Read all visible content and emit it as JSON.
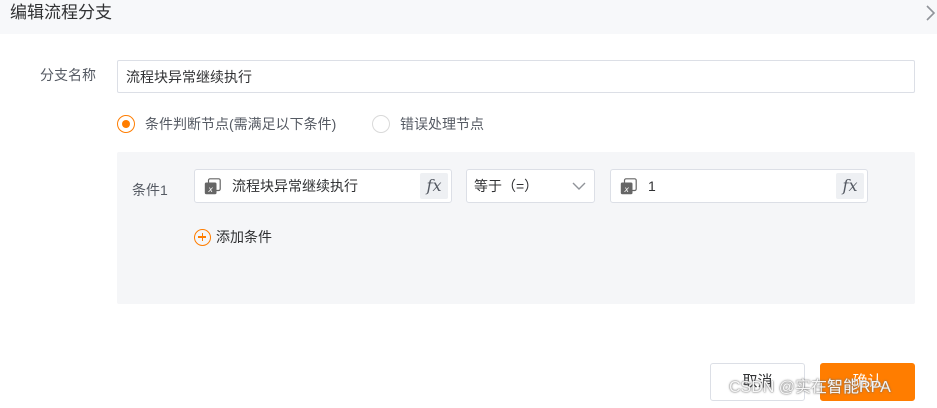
{
  "dialog": {
    "title": "编辑流程分支"
  },
  "form": {
    "branch_name_label": "分支名称",
    "branch_name_value": "流程块异常继续执行",
    "radio_options": [
      {
        "label": "条件判断节点(需满足以下条件)",
        "checked": true
      },
      {
        "label": "错误处理节点",
        "checked": false
      }
    ]
  },
  "condition": {
    "label": "条件1",
    "left_operand": "流程块异常继续执行",
    "operator": "等于（=）",
    "right_operand": "1",
    "fx_label": "fx",
    "add_label": "添加条件"
  },
  "footer": {
    "cancel_label": "取消",
    "confirm_label": "确认"
  },
  "watermark": "CSDN @实在智能RPA",
  "colors": {
    "accent": "#ff7d00",
    "panel_bg": "#f5f6f8",
    "border": "#dcdfe6"
  },
  "icons": {
    "variable": "variable-icon",
    "chevron": "chevron-down-icon",
    "close": "chevron-right-icon",
    "add": "plus-circle-icon"
  }
}
